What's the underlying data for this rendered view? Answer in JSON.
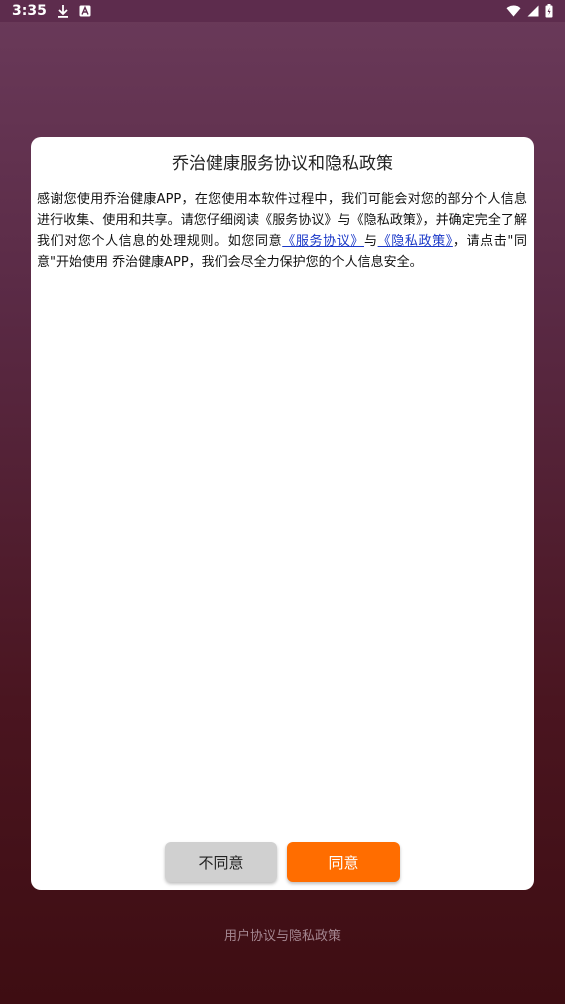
{
  "status_bar": {
    "time": "3:35",
    "icons": [
      "download-icon",
      "a-badge-icon",
      "wifi-icon",
      "signal-icon",
      "battery-icon"
    ]
  },
  "dialog": {
    "title": "乔治健康服务协议和隐私政策",
    "body_part1": "感谢您使用乔治健康APP，在您使用本软件过程中，我们可能会对您的部分个人信息进行收集、使用和共享。请您仔细阅读《服务协议》与《隐私政策》，并确定完全了解我们对您个人信息的处理规则。如您同意",
    "link_service": "《服务协议》",
    "connector": "与",
    "link_privacy": "《隐私政策》",
    "body_part2": "，请点击\"同意\"开始使用 乔治健康APP，我们会尽全力保护您的个人信息安全。",
    "disagree_label": "不同意",
    "agree_label": "同意"
  },
  "footer": {
    "link_text": "用户协议与隐私政策"
  },
  "colors": {
    "accent": "#ff6d00",
    "link": "#1a38c8",
    "disagree_bg": "#d0d0d0"
  }
}
